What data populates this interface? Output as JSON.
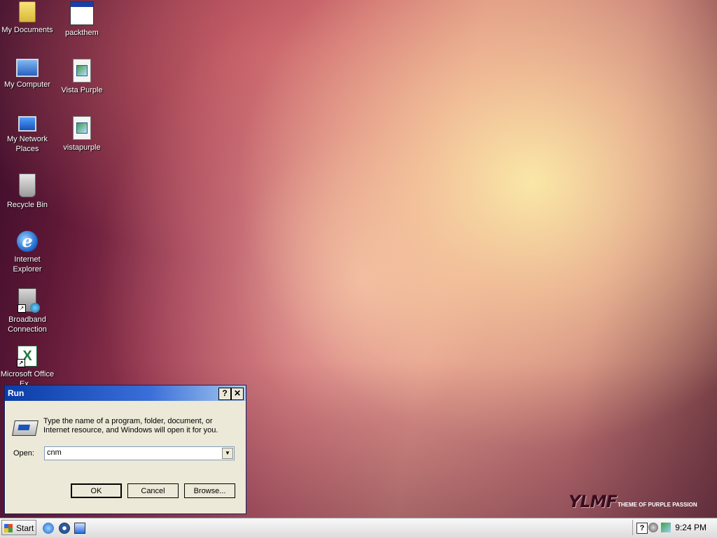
{
  "desktop": {
    "icons": [
      {
        "label": "My Documents",
        "icon": "folder-icon"
      },
      {
        "label": "packthem",
        "icon": "window-icon"
      },
      {
        "label": "My Computer",
        "icon": "computer-icon"
      },
      {
        "label": "Vista Purple",
        "icon": "image-file-icon"
      },
      {
        "label": "My Network Places",
        "icon": "network-icon"
      },
      {
        "label": "vistapurple",
        "icon": "image-file-icon"
      },
      {
        "label": "Recycle Bin",
        "icon": "recycle-bin-icon"
      },
      {
        "label": "Internet Explorer",
        "icon": "internet-explorer-icon"
      },
      {
        "label": "Broadband Connection",
        "icon": "broadband-icon"
      },
      {
        "label": "Microsoft Office Ex...",
        "icon": "excel-icon"
      }
    ]
  },
  "run_dialog": {
    "title": "Run",
    "help_label": "?",
    "close_label": "✕",
    "description": "Type the name of a program, folder, document, or Internet resource, and Windows will open it for you.",
    "open_label": "Open:",
    "open_value": "cnm",
    "ok_label": "OK",
    "cancel_label": "Cancel",
    "browse_label": "Browse..."
  },
  "watermark": {
    "logo": "YLMF",
    "tagline": "THEME OF PURPLE PASSION"
  },
  "taskbar": {
    "start_label": "Start",
    "quick_launch": [
      "internet-explorer-icon",
      "media-player-icon",
      "show-desktop-icon"
    ],
    "tray_help": "?",
    "clock": "9:24 PM"
  }
}
